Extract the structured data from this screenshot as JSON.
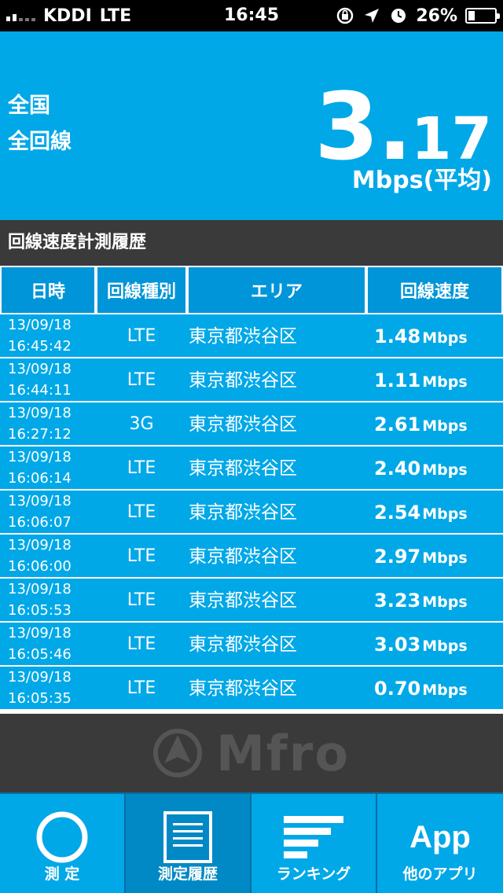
{
  "status_bar": {
    "carrier": "KDDI",
    "network": "LTE",
    "time": "16:45",
    "battery": "26%",
    "battery_level": 0.26
  },
  "summary": {
    "region_line1": "全国",
    "region_line2": "全回線",
    "speed_int": "3.",
    "speed_frac": "17",
    "unit": "Mbps(平均)"
  },
  "history": {
    "title": "回線速度計測履歴",
    "columns": [
      "日時",
      "回線種別",
      "エリア",
      "回線速度"
    ],
    "rows": [
      {
        "date": "13/09/18",
        "time": "16:45:42",
        "type": "LTE",
        "area": "東京都渋谷区",
        "speed": "1.48",
        "unit": "Mbps"
      },
      {
        "date": "13/09/18",
        "time": "16:44:11",
        "type": "LTE",
        "area": "東京都渋谷区",
        "speed": "1.11",
        "unit": "Mbps"
      },
      {
        "date": "13/09/18",
        "time": "16:27:12",
        "type": "3G",
        "area": "東京都渋谷区",
        "speed": "2.61",
        "unit": "Mbps"
      },
      {
        "date": "13/09/18",
        "time": "16:06:14",
        "type": "LTE",
        "area": "東京都渋谷区",
        "speed": "2.40",
        "unit": "Mbps"
      },
      {
        "date": "13/09/18",
        "time": "16:06:07",
        "type": "LTE",
        "area": "東京都渋谷区",
        "speed": "2.54",
        "unit": "Mbps"
      },
      {
        "date": "13/09/18",
        "time": "16:06:00",
        "type": "LTE",
        "area": "東京都渋谷区",
        "speed": "2.97",
        "unit": "Mbps"
      },
      {
        "date": "13/09/18",
        "time": "16:05:53",
        "type": "LTE",
        "area": "東京都渋谷区",
        "speed": "3.23",
        "unit": "Mbps"
      },
      {
        "date": "13/09/18",
        "time": "16:05:46",
        "type": "LTE",
        "area": "東京都渋谷区",
        "speed": "3.03",
        "unit": "Mbps"
      },
      {
        "date": "13/09/18",
        "time": "16:05:35",
        "type": "LTE",
        "area": "東京都渋谷区",
        "speed": "0.70",
        "unit": "Mbps"
      }
    ]
  },
  "logo": {
    "text": "Mfro"
  },
  "tabs": [
    {
      "label": "測 定",
      "icon": "ring-icon"
    },
    {
      "label": "測定履歴",
      "icon": "document-icon"
    },
    {
      "label": "ランキング",
      "icon": "ranking-bars-icon"
    },
    {
      "label": "他のアプリ",
      "icon": "app-text-icon",
      "icon_text": "App"
    }
  ],
  "active_tab": 1,
  "colors": {
    "accent": "#00a8e8",
    "accent_dark": "#0089c5",
    "header_dark": "#3a3a3a"
  }
}
